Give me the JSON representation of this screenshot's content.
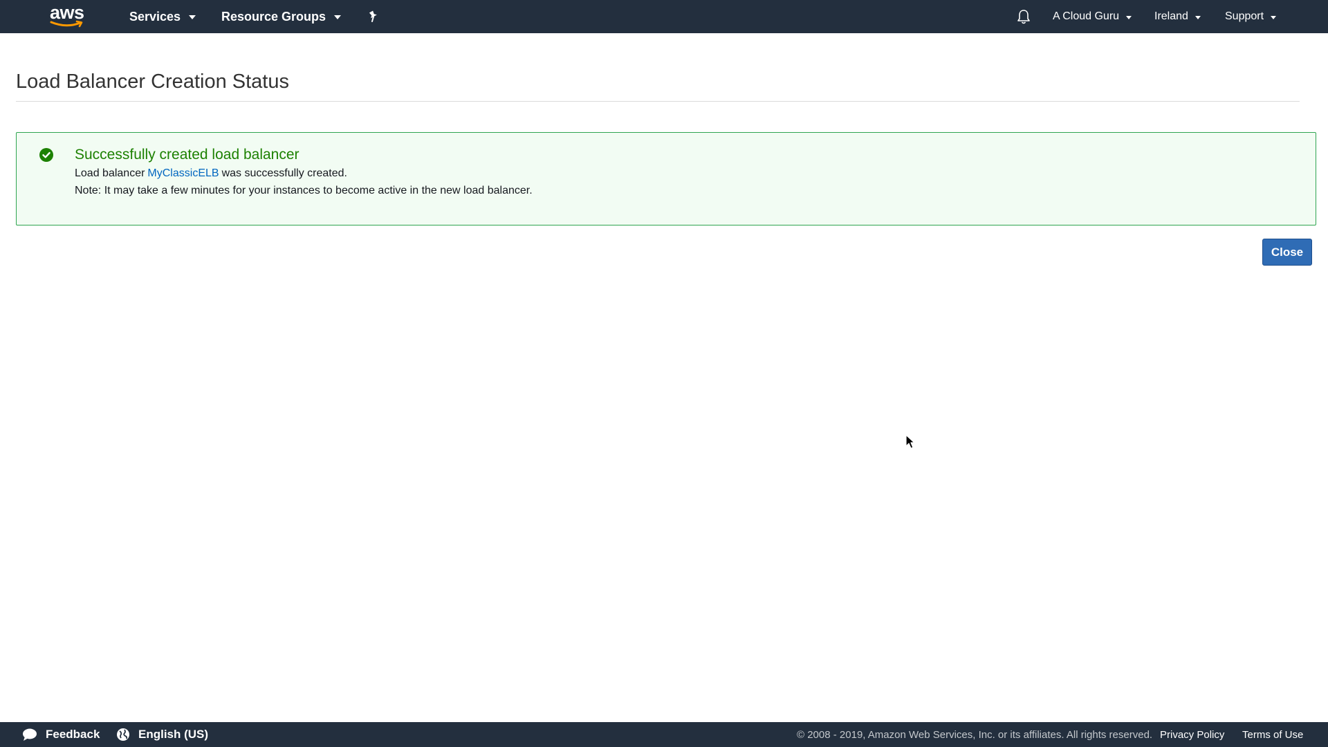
{
  "topnav": {
    "logo_text": "aws",
    "services_label": "Services",
    "resource_groups_label": "Resource Groups",
    "account_label": "A Cloud Guru",
    "region_label": "Ireland",
    "support_label": "Support"
  },
  "page": {
    "title": "Load Balancer Creation Status"
  },
  "alert": {
    "title": "Successfully created load balancer",
    "line1_prefix": "Load balancer",
    "link_text": "MyClassicELB",
    "line1_suffix": "was successfully created.",
    "line2": "Note: It may take a few minutes for your instances to become active in the new load balancer.",
    "status_color": "#1d8102"
  },
  "actions": {
    "close_label": "Close"
  },
  "footer": {
    "feedback_label": "Feedback",
    "language_label": "English (US)",
    "copyright": "© 2008 - 2019, Amazon Web Services, Inc. or its affiliates. All rights reserved.",
    "privacy_label": "Privacy Policy",
    "terms_label": "Terms of Use"
  },
  "colors": {
    "nav_bg": "#232f3e",
    "accent_button": "#2f6cb5",
    "link": "#0066c0",
    "success_border": "#2ea44f"
  },
  "icons": [
    "aws-logo",
    "chevron-down-icon",
    "pin-icon",
    "bell-icon",
    "check-circle-icon",
    "speech-bubble-icon",
    "globe-icon",
    "mouse-cursor-icon"
  ]
}
